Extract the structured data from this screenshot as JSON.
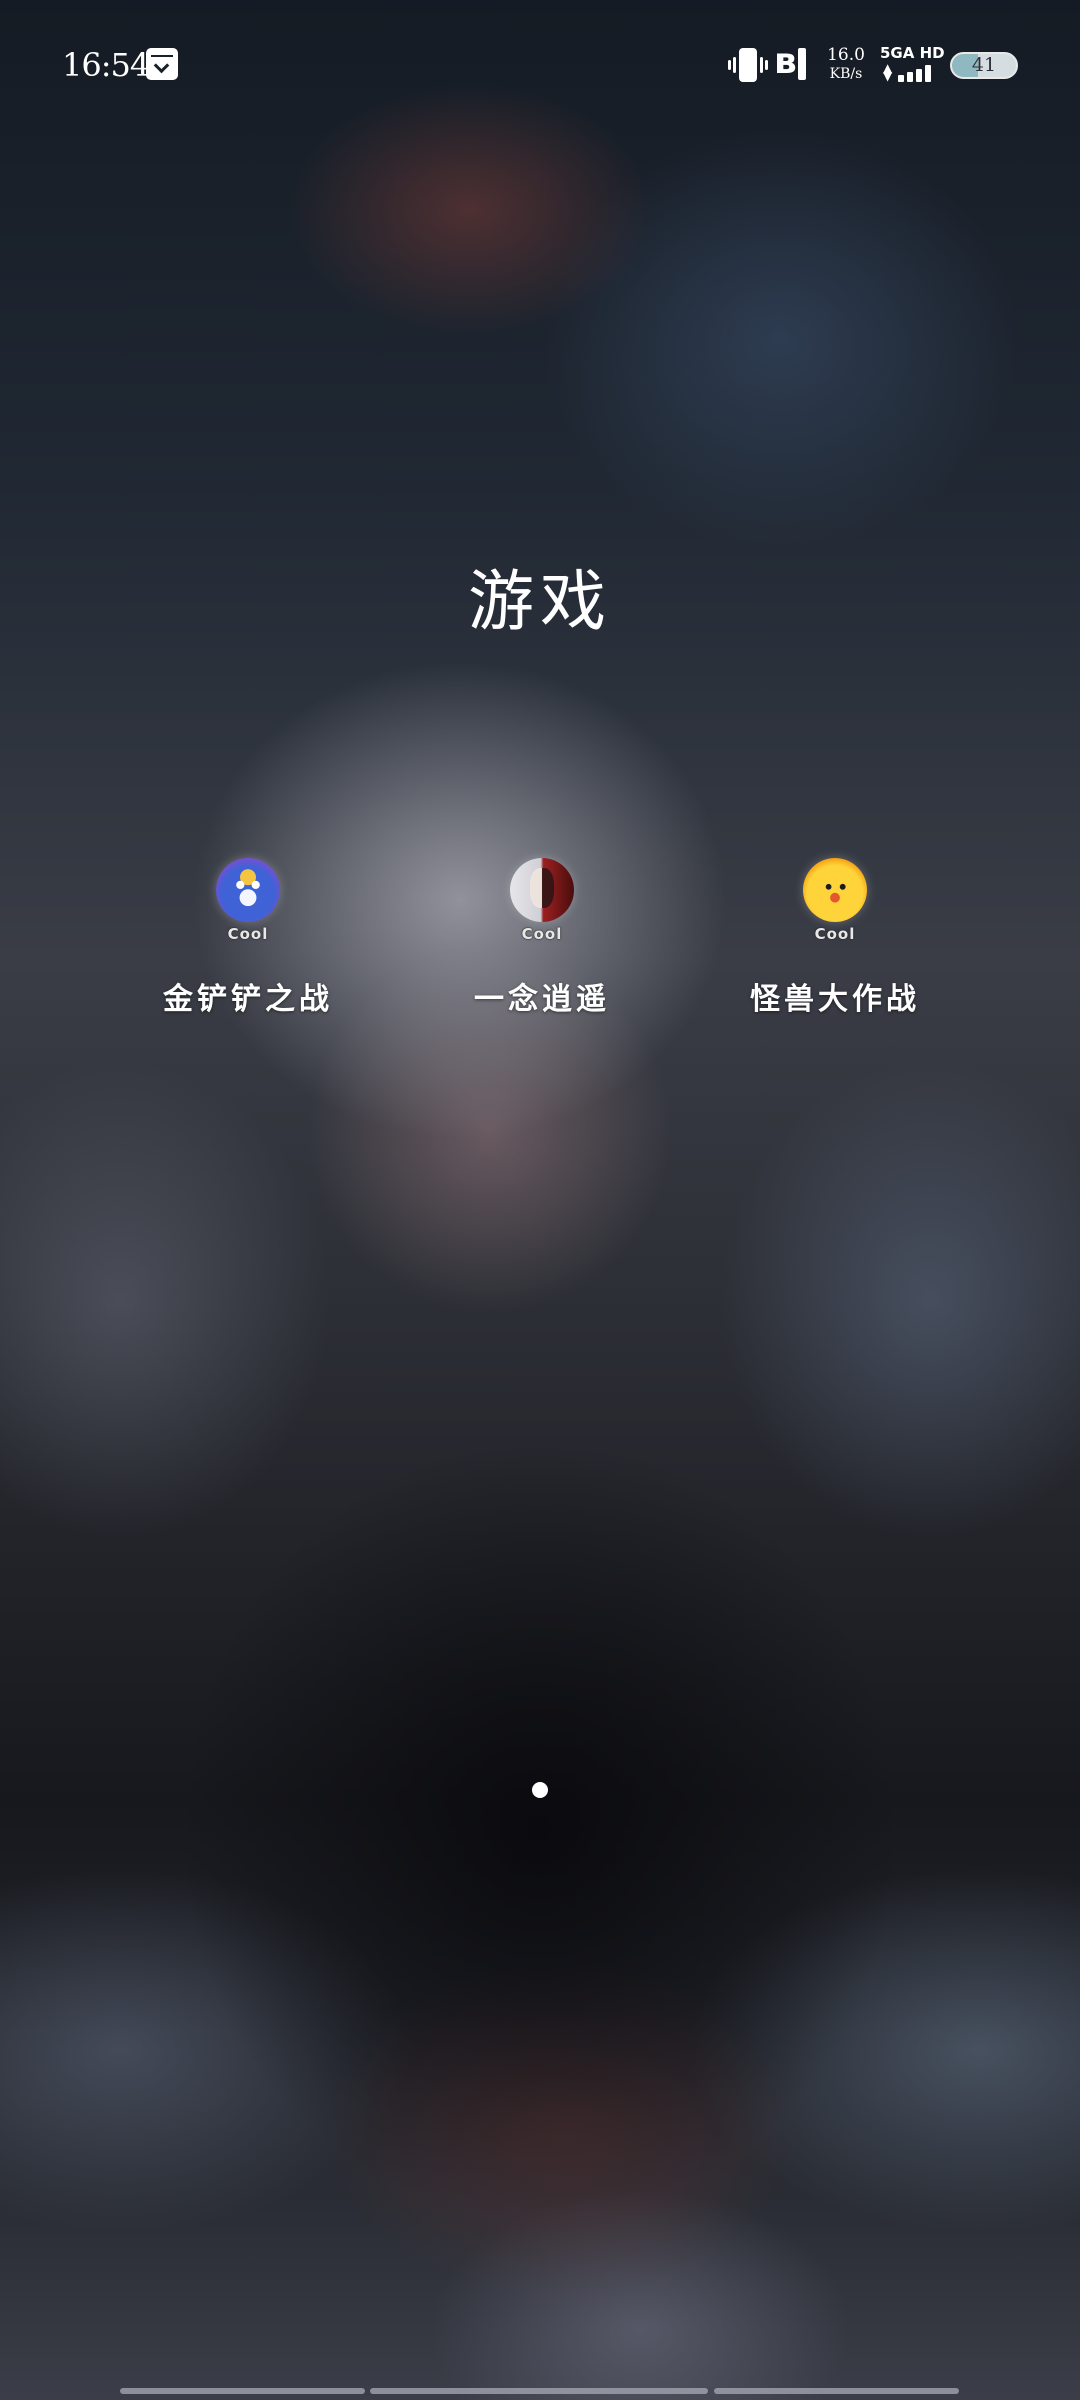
{
  "status_bar": {
    "time": "16:54",
    "notification_icon": "inbox-download-icon",
    "vibrate_icon": "vibrate-icon",
    "bluetooth_icon": "bluetooth-icon",
    "net_speed_value": "16.0",
    "net_speed_unit": "KB/s",
    "network_label": "5GA HD",
    "signal_icon": "signal-bars-icon",
    "battery_level": "41",
    "battery_fraction": 0.41
  },
  "folder": {
    "title": "游戏",
    "apps": [
      {
        "label": "金铲铲之战",
        "badge": "Cool",
        "icon": "penguin-mascot-icon"
      },
      {
        "label": "一念逍遥",
        "badge": "Cool",
        "icon": "warrior-face-icon"
      },
      {
        "label": "怪兽大作战",
        "badge": "Cool",
        "icon": "yellow-chick-icon"
      }
    ]
  },
  "pagination": {
    "current_page": 1,
    "total_pages": 1
  },
  "colors": {
    "text": "#ffffff",
    "battery_fill": "#8fb8c0"
  }
}
